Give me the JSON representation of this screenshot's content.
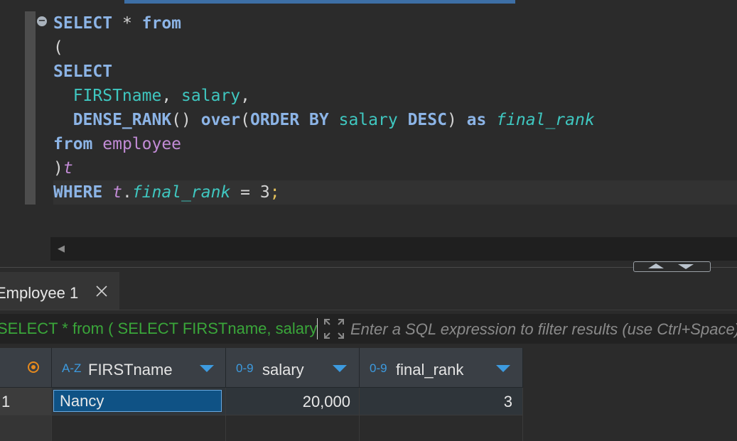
{
  "editor": {
    "fold_glyph": "−",
    "lines": [
      [
        {
          "t": "SELECT",
          "c": "kw"
        },
        {
          "t": " * ",
          "c": "pun"
        },
        {
          "t": "from",
          "c": "kw"
        }
      ],
      [
        {
          "t": "(",
          "c": "pun"
        }
      ],
      [
        {
          "t": "SELECT",
          "c": "kw"
        }
      ],
      [
        {
          "t": "  FIRSTname",
          "c": "id"
        },
        {
          "t": ", ",
          "c": "pun"
        },
        {
          "t": "salary",
          "c": "id"
        },
        {
          "t": ",",
          "c": "pun"
        }
      ],
      [
        {
          "t": "  DENSE_RANK",
          "c": "kw"
        },
        {
          "t": "() ",
          "c": "pun"
        },
        {
          "t": "over",
          "c": "kw"
        },
        {
          "t": "(",
          "c": "pun"
        },
        {
          "t": "ORDER BY",
          "c": "kw"
        },
        {
          "t": " ",
          "c": "pun"
        },
        {
          "t": "salary",
          "c": "id"
        },
        {
          "t": " ",
          "c": "pun"
        },
        {
          "t": "DESC",
          "c": "kw"
        },
        {
          "t": ") ",
          "c": "pun"
        },
        {
          "t": "as",
          "c": "kw"
        },
        {
          "t": " ",
          "c": "pun"
        },
        {
          "t": "final_rank",
          "c": "al"
        }
      ],
      [
        {
          "t": "from",
          "c": "kw"
        },
        {
          "t": " ",
          "c": "pun"
        },
        {
          "t": "employee",
          "c": "tbl"
        }
      ],
      [
        {
          "t": ")",
          "c": "pun"
        },
        {
          "t": "t",
          "c": "als"
        }
      ],
      [
        {
          "t": "WHERE",
          "c": "kw"
        },
        {
          "t": " ",
          "c": "pun"
        },
        {
          "t": "t",
          "c": "als"
        },
        {
          "t": ".",
          "c": "pun"
        },
        {
          "t": "final_rank",
          "c": "al"
        },
        {
          "t": " = 3",
          "c": "num"
        },
        {
          "t": ";",
          "c": "semi"
        }
      ]
    ],
    "current_line": 7
  },
  "results": {
    "tab_label": "Employee 1",
    "filter": {
      "query_text": "SELECT * from ( SELECT FIRSTname, salary",
      "placeholder": "Enter a SQL expression to filter results (use Ctrl+Space)"
    },
    "columns": [
      {
        "type": "A-Z",
        "name": "FIRSTname"
      },
      {
        "type": "0-9",
        "name": "salary"
      },
      {
        "type": "0-9",
        "name": "final_rank"
      }
    ],
    "rows": [
      {
        "num": "1",
        "FIRSTname": "Nancy",
        "salary": "20,000",
        "final_rank": "3"
      }
    ]
  },
  "colors": {
    "keyword": "#8cb4e6",
    "identifier": "#3fc7c0",
    "table": "#c28bd6",
    "filter_text": "#3aa63a",
    "selection": "#0f5285",
    "accent": "#3d9be0"
  }
}
